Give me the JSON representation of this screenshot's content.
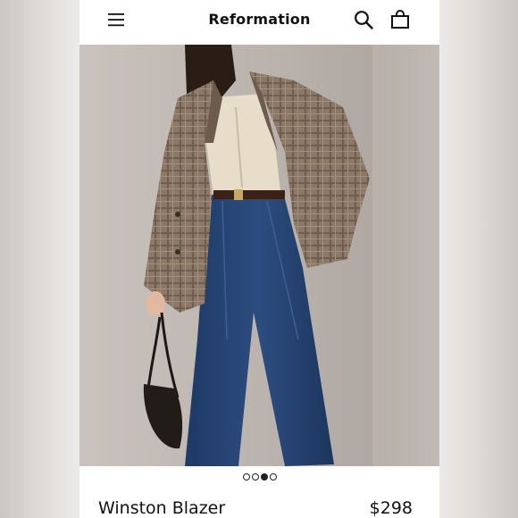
{
  "header": {
    "brand": "Reformation",
    "menu_icon": "hamburger-menu-icon",
    "search_icon": "search-icon",
    "bag_icon": "shopping-bag-icon"
  },
  "gallery": {
    "image_count": 4,
    "active_index": 2
  },
  "product": {
    "name": "Winston Blazer",
    "price": "$298"
  },
  "colors": {
    "text": "#111111",
    "background": "#ffffff"
  }
}
